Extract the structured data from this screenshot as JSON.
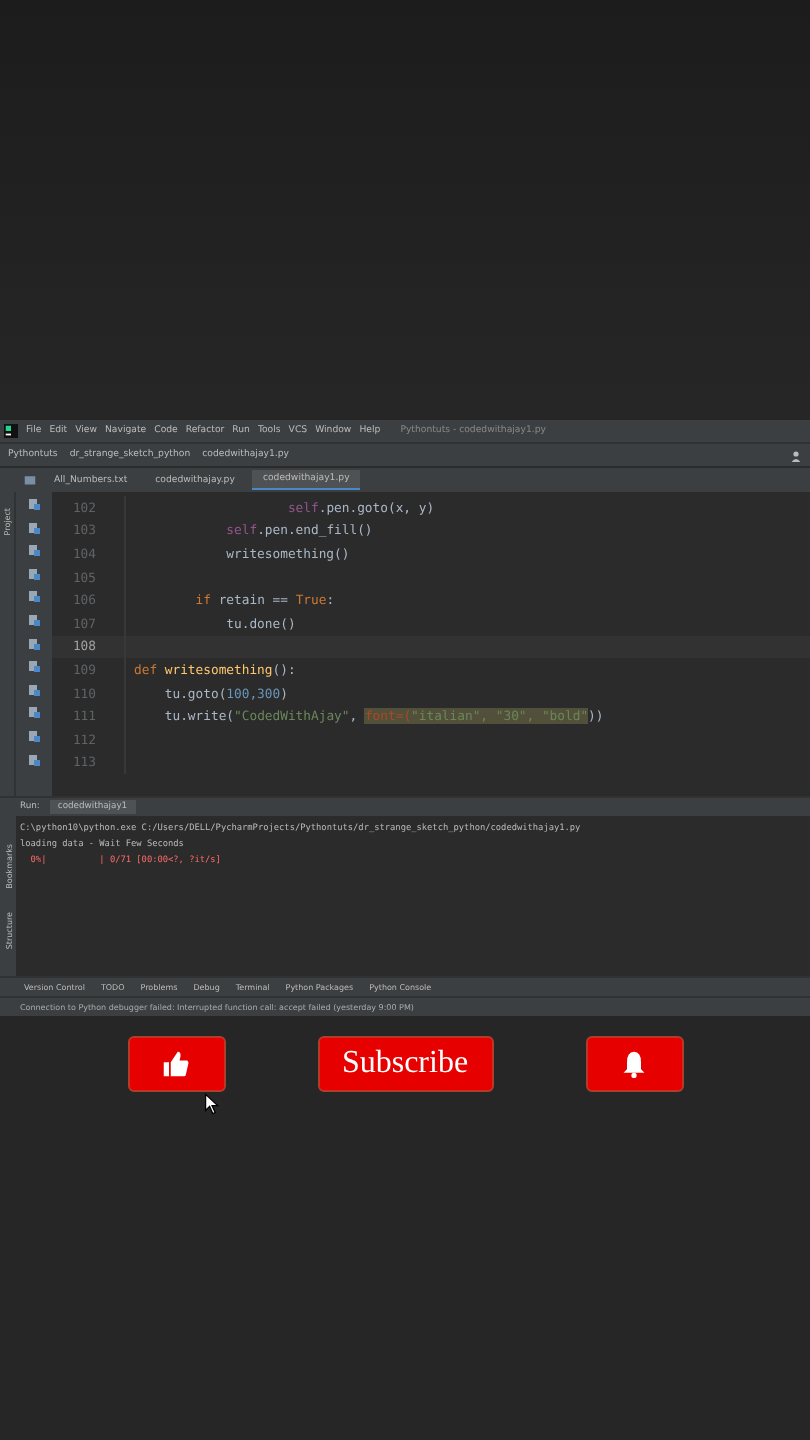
{
  "menu": {
    "items": [
      "File",
      "Edit",
      "View",
      "Navigate",
      "Code",
      "Refactor",
      "Run",
      "Tools",
      "VCS",
      "Window",
      "Help"
    ],
    "title": "Pythontuts - codedwithajay1.py"
  },
  "breadcrumbs": [
    "Pythontuts",
    "dr_strange_sketch_python",
    "codedwithajay1.py"
  ],
  "tabs": [
    {
      "label": "All_Numbers.txt",
      "selected": false
    },
    {
      "label": "codedwithajay.py",
      "selected": false
    },
    {
      "label": "codedwithajay1.py",
      "selected": true
    }
  ],
  "side_tools": [
    "Project",
    "Bookmarks",
    "Structure"
  ],
  "lines": [
    {
      "number": "102",
      "current": false,
      "tokens": [
        {
          "kind": "self",
          "text": "                    self"
        },
        {
          "kind": "plain",
          "text": ".pen.goto(x, y)"
        }
      ]
    },
    {
      "number": "103",
      "current": false,
      "tokens": [
        {
          "kind": "self",
          "text": "            self"
        },
        {
          "kind": "plain",
          "text": ".pen.end_fill()"
        }
      ]
    },
    {
      "number": "104",
      "current": false,
      "tokens": [
        {
          "kind": "plain",
          "text": "            writesomething()"
        }
      ]
    },
    {
      "number": "105",
      "current": false
    },
    {
      "number": "106",
      "current": false,
      "tokens": [
        {
          "kind": "kw",
          "text": "        if "
        },
        {
          "kind": "plain",
          "text": "retain == "
        },
        {
          "kind": "kw",
          "text": "True"
        },
        {
          "kind": "plain",
          "text": ":"
        }
      ]
    },
    {
      "number": "107",
      "current": false,
      "tokens": [
        {
          "kind": "plain",
          "text": "            tu.done()"
        }
      ]
    },
    {
      "number": "108",
      "current": true
    },
    {
      "number": "109",
      "current": false,
      "tokens": [
        {
          "kind": "kw",
          "text": "def "
        },
        {
          "kind": "fn",
          "text": "writesomething"
        },
        {
          "kind": "plain",
          "text": "():"
        }
      ]
    },
    {
      "number": "110",
      "current": false,
      "tokens": [
        {
          "kind": "plain",
          "text": "    tu.goto("
        },
        {
          "kind": "num",
          "text": "100,300"
        },
        {
          "kind": "plain",
          "text": ")"
        }
      ]
    },
    {
      "number": "111",
      "current": false,
      "tokens": [
        {
          "kind": "plain",
          "text": "    tu.write("
        },
        {
          "kind": "str",
          "text": "\"CodedWithAjay\""
        },
        {
          "kind": "plain",
          "text": ", "
        },
        {
          "kind": "hl",
          "text": "font=("
        },
        {
          "kind": "hlstr",
          "text": "\"italian\", \"30\", \"bold\""
        },
        {
          "kind": "plain",
          "text": "))"
        }
      ]
    },
    {
      "number": "112",
      "current": false
    },
    {
      "number": "113",
      "current": false
    }
  ],
  "run": {
    "label": "Run:",
    "config": "codedwithajay1"
  },
  "console": [
    {
      "kind": "out",
      "text": "C:\\python10\\python.exe C:/Users/DELL/PycharmProjects/Pythontuts/dr_strange_sketch_python/codedwithajay1.py"
    },
    {
      "kind": "out",
      "text": "loading data - Wait Few Seconds"
    },
    {
      "kind": "err",
      "text": "  0%|          | 0/71 [00:00<?, ?it/s]"
    }
  ],
  "tool_tabs": [
    "Version Control",
    "TODO",
    "Problems",
    "Debug",
    "Terminal",
    "Python Packages",
    "Python Console"
  ],
  "status": "Connection to Python debugger failed: Interrupted function call: accept failed (yesterday 9:00 PM)",
  "actions": [
    {
      "kind": "like"
    },
    {
      "kind": "subscribe",
      "label": "Subscribe"
    },
    {
      "kind": "bell"
    }
  ]
}
